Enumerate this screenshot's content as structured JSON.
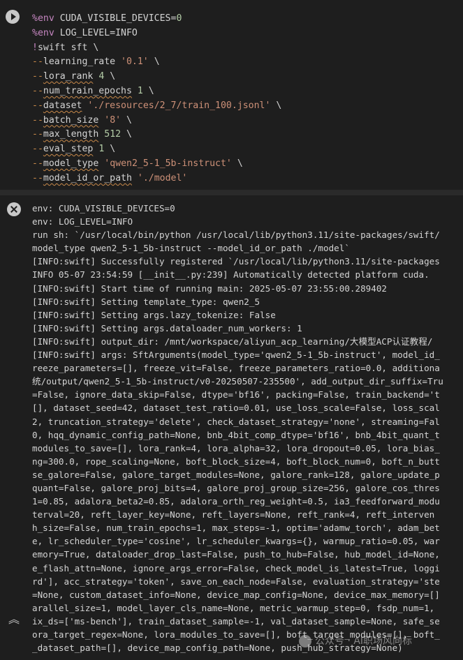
{
  "code_cell": {
    "lines": [
      {
        "parts": [
          {
            "t": "%env",
            "c": "mag"
          },
          {
            "t": " CUDA_VISIBLE_DEVICES=",
            "c": "val"
          },
          {
            "t": "0",
            "c": "num"
          }
        ]
      },
      {
        "parts": [
          {
            "t": "%env",
            "c": "mag"
          },
          {
            "t": " LOG_LEVEL=INFO",
            "c": "val"
          }
        ]
      },
      {
        "parts": [
          {
            "t": "!",
            "c": "mag"
          },
          {
            "t": "swift sft \\",
            "c": "bang"
          }
        ]
      },
      {
        "parts": [
          {
            "t": "--",
            "c": "dash"
          },
          {
            "t": "learning_rate ",
            "c": "val"
          },
          {
            "t": "'0.1'",
            "c": "str"
          },
          {
            "t": " \\",
            "c": "val"
          }
        ]
      },
      {
        "parts": [
          {
            "t": "--",
            "c": "dash"
          },
          {
            "t": "lora_rank",
            "c": "flag"
          },
          {
            "t": " ",
            "c": "val"
          },
          {
            "t": "4",
            "c": "num"
          },
          {
            "t": " \\",
            "c": "val"
          }
        ]
      },
      {
        "parts": [
          {
            "t": "--",
            "c": "dash"
          },
          {
            "t": "num_train_epochs",
            "c": "flag"
          },
          {
            "t": " ",
            "c": "val"
          },
          {
            "t": "1",
            "c": "num"
          },
          {
            "t": " \\",
            "c": "val"
          }
        ]
      },
      {
        "parts": [
          {
            "t": "--",
            "c": "dash"
          },
          {
            "t": "dataset",
            "c": "flag"
          },
          {
            "t": " ",
            "c": "val"
          },
          {
            "t": "'./resources/2_7/train_100.jsonl'",
            "c": "str"
          },
          {
            "t": " \\",
            "c": "val"
          }
        ]
      },
      {
        "parts": [
          {
            "t": "--",
            "c": "dash"
          },
          {
            "t": "batch_size",
            "c": "flag"
          },
          {
            "t": " ",
            "c": "val"
          },
          {
            "t": "'8'",
            "c": "str"
          },
          {
            "t": " \\",
            "c": "val"
          }
        ]
      },
      {
        "parts": [
          {
            "t": "--",
            "c": "dash"
          },
          {
            "t": "max_length",
            "c": "flag"
          },
          {
            "t": " ",
            "c": "val"
          },
          {
            "t": "512",
            "c": "num"
          },
          {
            "t": " \\",
            "c": "val"
          }
        ]
      },
      {
        "parts": [
          {
            "t": "--",
            "c": "dash"
          },
          {
            "t": "eval_step",
            "c": "flag"
          },
          {
            "t": " ",
            "c": "val"
          },
          {
            "t": "1",
            "c": "num"
          },
          {
            "t": " \\",
            "c": "val"
          }
        ]
      },
      {
        "parts": [
          {
            "t": "--",
            "c": "dash"
          },
          {
            "t": "model_type",
            "c": "flag"
          },
          {
            "t": " ",
            "c": "val"
          },
          {
            "t": "'qwen2_5-1_5b-instruct'",
            "c": "str"
          },
          {
            "t": " \\",
            "c": "val"
          }
        ]
      },
      {
        "parts": [
          {
            "t": "--",
            "c": "dash"
          },
          {
            "t": "model_id_or_path",
            "c": "flag"
          },
          {
            "t": " ",
            "c": "val"
          },
          {
            "t": "'./model'",
            "c": "str"
          }
        ]
      }
    ]
  },
  "output": {
    "lines": [
      "env: CUDA_VISIBLE_DEVICES=0",
      "env: LOG_LEVEL=INFO",
      "run sh: `/usr/local/bin/python /usr/local/lib/python3.11/site-packages/swift/",
      "model_type qwen2_5-1_5b-instruct --model_id_or_path ./model`",
      "[INFO:swift] Successfully registered `/usr/local/lib/python3.11/site-packages",
      "INFO 05-07 23:54:59 [__init__.py:239] Automatically detected platform cuda.",
      "[INFO:swift] Start time of running main: 2025-05-07 23:55:00.289402",
      "[INFO:swift] Setting template_type: qwen2_5",
      "[INFO:swift] Setting args.lazy_tokenize: False",
      "[INFO:swift] Setting args.dataloader_num_workers: 1",
      "[INFO:swift] output_dir: /mnt/workspace/aliyun_acp_learning/大模型ACP认证教程/",
      "[INFO:swift] args: SftArguments(model_type='qwen2_5-1_5b-instruct', model_id_",
      "reeze_parameters=[], freeze_vit=False, freeze_parameters_ratio=0.0, additiona",
      "统/output/qwen2_5-1_5b-instruct/v0-20250507-235500', add_output_dir_suffix=Tru",
      "=False, ignore_data_skip=False, dtype='bf16', packing=False, train_backend='t",
      "[], dataset_seed=42, dataset_test_ratio=0.01, use_loss_scale=False, loss_scal",
      "2, truncation_strategy='delete', check_dataset_strategy='none', streaming=Fal",
      "0, hqq_dynamic_config_path=None, bnb_4bit_comp_dtype='bf16', bnb_4bit_quant_t",
      "modules_to_save=[], lora_rank=4, lora_alpha=32, lora_dropout=0.05, lora_bias_",
      "ng=300.0, rope_scaling=None, boft_block_size=4, boft_block_num=0, boft_n_butt",
      "se_galore=False, galore_target_modules=None, galore_rank=128, galore_update_p",
      "quant=False, galore_proj_bits=4, galore_proj_group_size=256, galore_cos_thres",
      "1=0.85, adalora_beta2=0.85, adalora_orth_reg_weight=0.5, ia3_feedforward_modu",
      "terval=20, reft_layer_key=None, reft_layers=None, reft_rank=4, reft_interven",
      "h_size=False, num_train_epochs=1, max_steps=-1, optim='adamw_torch', adam_bet",
      "e, lr_scheduler_type='cosine', lr_scheduler_kwargs={}, warmup_ratio=0.05, war",
      "emory=True, dataloader_drop_last=False, push_to_hub=False, hub_model_id=None,",
      "e_flash_attn=None, ignore_args_error=False, check_model_is_latest=True, loggi",
      "rd'], acc_strategy='token', save_on_each_node=False, evaluation_strategy='ste",
      "=None, custom_dataset_info=None, device_map_config=None, device_max_memory=[]",
      "arallel_size=1, model_layer_cls_name=None, metric_warmup_step=0, fsdp_num=1,",
      "ix_ds=['ms-bench'], train_dataset_sample=-1, val_dataset_sample=None, safe_se",
      "ora_target_regex=None, lora_modules_to_save=[], boft_target_modules=[], boft_",
      "_dataset_path=[], device_map_config_path=None, push_hub_strategy=None)"
    ]
  },
  "watermark": {
    "text": "公众号 · AI职场风向标"
  },
  "icons": {
    "run": "play-icon",
    "clear_output": "close-icon",
    "collapse": "double-chevron-up-icon"
  }
}
